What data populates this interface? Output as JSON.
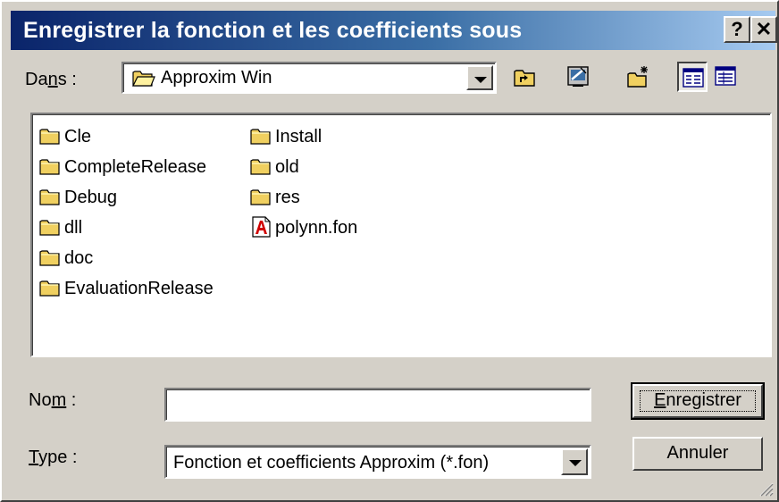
{
  "window": {
    "title": "Enregistrer la fonction et les coefficients sous",
    "help_glyph": "?",
    "close_glyph": "✕"
  },
  "location": {
    "label_prefix": "Da",
    "label_mnemonic": "n",
    "label_suffix": "s :",
    "value": "Approxim Win"
  },
  "files": {
    "column1": [
      "Cle",
      "CompleteRelease",
      "Debug",
      "dll",
      "doc",
      "EvaluationRelease"
    ],
    "column2": [
      "Install",
      "old",
      "res",
      "polynn.fon"
    ]
  },
  "name_field": {
    "label_prefix": "No",
    "label_mnemonic": "m",
    "label_suffix": " :",
    "value": ""
  },
  "type_field": {
    "label_mnemonic": "T",
    "label_suffix": "ype :",
    "value": "Fonction et coefficients Approxim (*.fon)"
  },
  "buttons": {
    "save_mnemonic": "E",
    "save_rest": "nregistrer",
    "cancel": "Annuler"
  },
  "colors": {
    "title_start": "#0a246a",
    "title_end": "#a6caf0",
    "face": "#d4d0c8",
    "folder": "#f0d060"
  }
}
